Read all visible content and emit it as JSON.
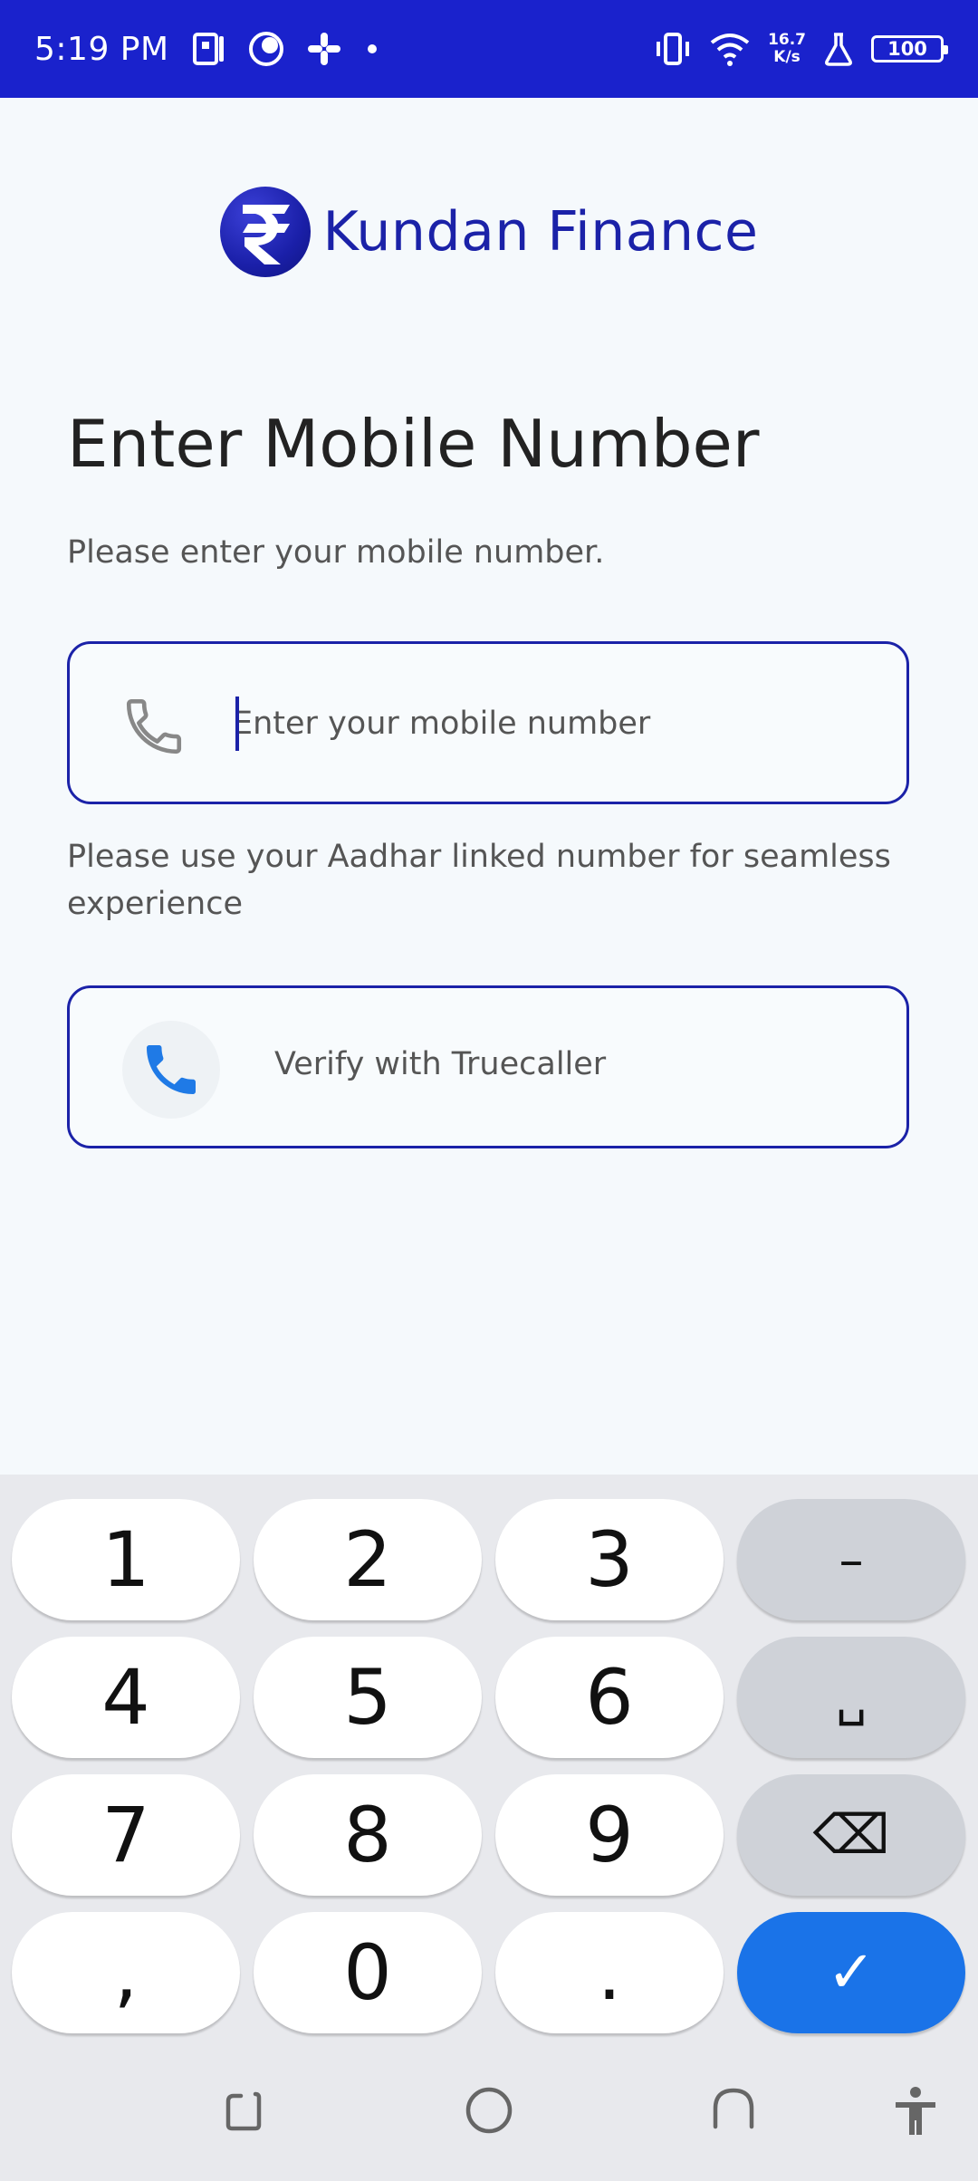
{
  "status_bar": {
    "time": "5:19 PM",
    "net_speed_value": "16.7",
    "net_speed_unit": "K/s",
    "battery": "100"
  },
  "logo": {
    "text": "Kundan Finance",
    "symbol": "₹"
  },
  "page": {
    "title": "Enter Mobile Number",
    "subtitle": "Please enter your mobile number.",
    "mobile_input_placeholder": "Enter your mobile number",
    "mobile_input_value": "",
    "helper_text": "Please use your Aadhar linked number for seamless experience",
    "truecaller_label": "Verify with Truecaller"
  },
  "keyboard": {
    "rows": [
      [
        "1",
        "2",
        "3",
        "–"
      ],
      [
        "4",
        "5",
        "6",
        "␣"
      ],
      [
        "7",
        "8",
        "9",
        "⌫"
      ],
      [
        ",",
        "0",
        ".",
        "✓"
      ]
    ]
  },
  "colors": {
    "status_bar": "#1a22cc",
    "brand": "#1b22a8",
    "enter_key": "#1a73e8"
  }
}
